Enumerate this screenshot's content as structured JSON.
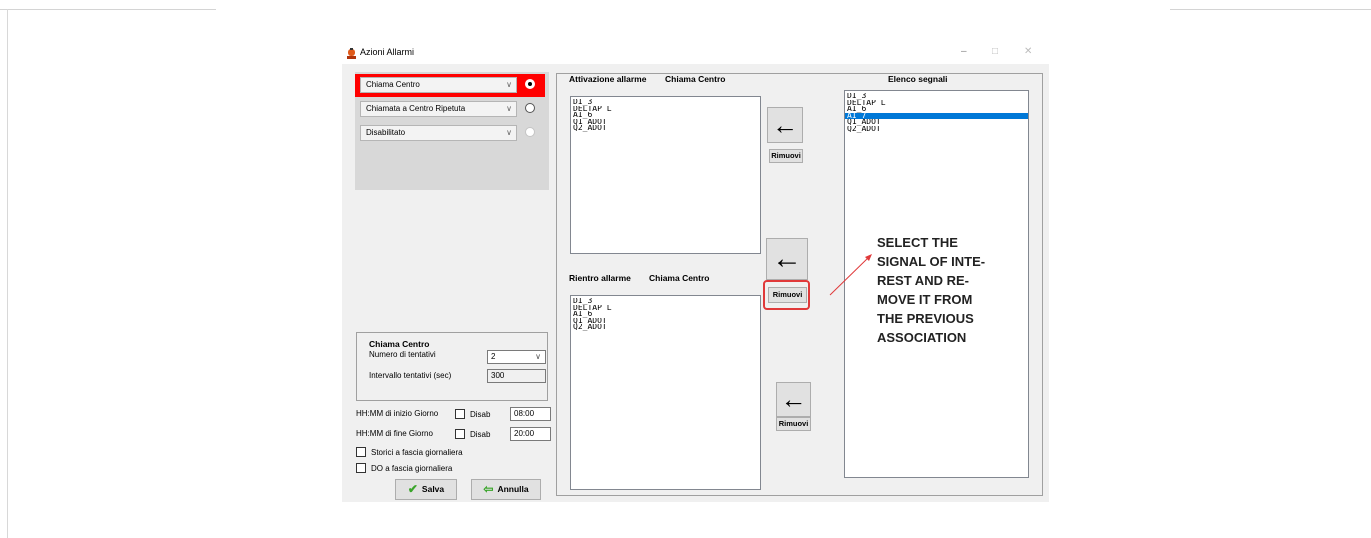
{
  "window": {
    "title": "Azioni Allarmi",
    "minimize_glyph": "–",
    "maximize_glyph": "□",
    "close_glyph": "✕"
  },
  "modes": [
    {
      "label": "Chiama Centro",
      "selected": true
    },
    {
      "label": "Chiamata a Centro Ripetuta",
      "selected": false
    },
    {
      "label": "Disabilitato",
      "selected": false
    }
  ],
  "chiama_centro_group": {
    "title": "Chiama Centro",
    "attempts_label": "Numero di tentativi",
    "attempts_value": "2",
    "interval_label": "Intervallo tentativi (sec)",
    "interval_value": "300"
  },
  "day_schedule": {
    "start_label": "HH:MM di inizio Giorno",
    "start_disab_label": "Disab",
    "start_value": "08:00",
    "end_label": "HH:MM di fine Giorno",
    "end_disab_label": "Disab",
    "end_value": "20:00",
    "storici_label": "Storici a fascia giornaliera",
    "do_label": "DO a fascia giornaliera"
  },
  "buttons": {
    "save": "Salva",
    "cancel": "Annulla",
    "remove": "Rimuovi",
    "arrow_glyph": "←"
  },
  "activation": {
    "label": "Attivazione allarme",
    "target": "Chiama Centro",
    "items": [
      "DI_3",
      "DELTAP_L",
      "AI_6",
      "Q1_ADOT",
      "Q2_ADOT"
    ]
  },
  "return": {
    "label": "Rientro allarme",
    "target": "Chiama Centro",
    "items": [
      "DI_3",
      "DELTAP_L",
      "AI_6",
      "Q1_ADOT",
      "Q2_ADOT"
    ]
  },
  "signals": {
    "label": "Elenco segnali",
    "items": [
      "DI_3",
      "DELTAP_L",
      "AI_6",
      "AI_7",
      "Q1_ADOT",
      "Q2_ADOT"
    ],
    "selected_item": "AI_7"
  },
  "annotation": {
    "text": "SELECT THE\nSIGNAL OF INTE-\nREST AND RE-\nMOVE IT FROM\nTHE PREVIOUS\nASSOCIATION"
  },
  "colors": {
    "highlight_red": "#e0393a",
    "selected_mode_red": "#ff0000",
    "selection_blue": "#0078d7",
    "window_bg": "#f0f0f0"
  }
}
